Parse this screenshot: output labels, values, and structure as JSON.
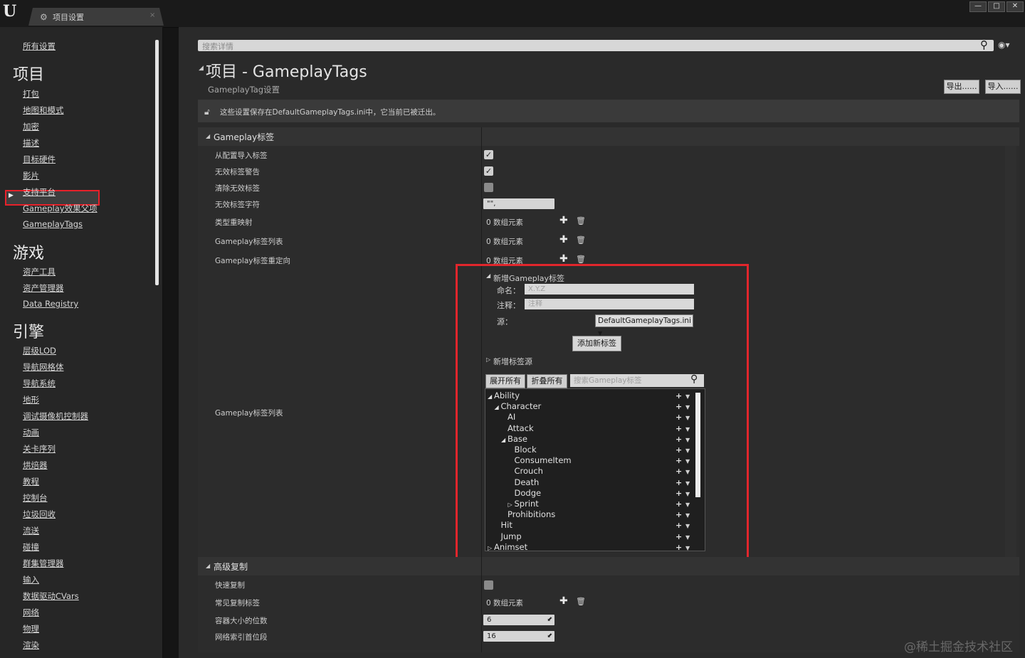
{
  "window": {
    "tab_label": "项目设置",
    "tab_close": "×",
    "logo": "U",
    "controls": {
      "minimize": "—",
      "maximize": "□",
      "close": "✕"
    }
  },
  "sidebar": {
    "all_settings": "所有设置",
    "sections": [
      {
        "title": "项目",
        "items": [
          "打包",
          "地图和模式",
          "加密",
          "描述",
          "目标硬件",
          "影片",
          "支持平台",
          "Gameplay效果父项",
          "GameplayTags"
        ]
      },
      {
        "title": "游戏",
        "items": [
          "资产工具",
          "资产管理器",
          "Data Registry"
        ]
      },
      {
        "title": "引擎",
        "items": [
          "层级LOD",
          "导航网格体",
          "导航系统",
          "地形",
          "调试摄像机控制器",
          "动画",
          "关卡序列",
          "烘焙器",
          "教程",
          "控制台",
          "垃圾回收",
          "流送",
          "碰撞",
          "群集管理器",
          "输入",
          "数据驱动CVars",
          "网络",
          "物理",
          "渲染"
        ]
      }
    ],
    "selected": "GameplayTags"
  },
  "main": {
    "search_placeholder": "搜索详情",
    "title": "项目 - GameplayTags",
    "subtitle": "GameplayTag设置",
    "export_label": "导出......",
    "import_label": "导入......",
    "notice": "这些设置保存在DefaultGameplayTags.ini中，它当前已被迁出。",
    "category1": "Gameplay标签",
    "props": {
      "import_from_config": "从配置导入标签",
      "warn_invalid": "无效标签警告",
      "clear_invalid": "清除无效标签",
      "invalid_chars": "无效标签字符",
      "invalid_chars_value": "\"\",",
      "category_remap": "类型重映射",
      "tag_list": "Gameplay标签列表",
      "tag_redirects": "Gameplay标签重定向",
      "tag_list2": "Gameplay标签列表",
      "zero_elements": "0 数组元素"
    },
    "checkboxes": {
      "import_from_config": true,
      "warn_invalid": true,
      "clear_invalid": false
    },
    "new_tag": {
      "header": "新增Gameplay标签",
      "name_label": "命名：",
      "name_placeholder": "X.Y.Z",
      "comment_label": "注释：",
      "comment_placeholder": "注释",
      "source_label": "源：",
      "source_value": "DefaultGameplayTags.ini",
      "add_button": "添加新标签",
      "new_source": "新增标签源"
    },
    "tree_controls": {
      "expand_all": "展开所有",
      "collapse_all": "折叠所有",
      "search_placeholder": "搜索Gameplay标签"
    },
    "tag_tree": [
      {
        "label": "Ability",
        "indent": 0,
        "arrow": "◢"
      },
      {
        "label": "Character",
        "indent": 1,
        "arrow": "◢"
      },
      {
        "label": "AI",
        "indent": 2,
        "arrow": ""
      },
      {
        "label": "Attack",
        "indent": 2,
        "arrow": ""
      },
      {
        "label": "Base",
        "indent": 2,
        "arrow": "◢"
      },
      {
        "label": "Block",
        "indent": 3,
        "arrow": ""
      },
      {
        "label": "ConsumeItem",
        "indent": 3,
        "arrow": ""
      },
      {
        "label": "Crouch",
        "indent": 3,
        "arrow": ""
      },
      {
        "label": "Death",
        "indent": 3,
        "arrow": ""
      },
      {
        "label": "Dodge",
        "indent": 3,
        "arrow": ""
      },
      {
        "label": "Sprint",
        "indent": 3,
        "arrow": "▷"
      },
      {
        "label": "Prohibitions",
        "indent": 2,
        "arrow": ""
      },
      {
        "label": "Hit",
        "indent": 1,
        "arrow": ""
      },
      {
        "label": "Jump",
        "indent": 1,
        "arrow": ""
      },
      {
        "label": "Animset",
        "indent": 0,
        "arrow": "▷"
      }
    ],
    "category2": "高级复制",
    "adv_props": {
      "fast_replication": "快速复制",
      "common_replicated": "常见复制标签",
      "container_bits": "容器大小的位数",
      "container_bits_value": "6",
      "net_index_segment": "网络索引首位段",
      "net_index_segment_value": "16",
      "zero_elements": "0 数组元素"
    },
    "fast_replication_checked": false
  },
  "watermark": "@稀土掘金技术社区"
}
